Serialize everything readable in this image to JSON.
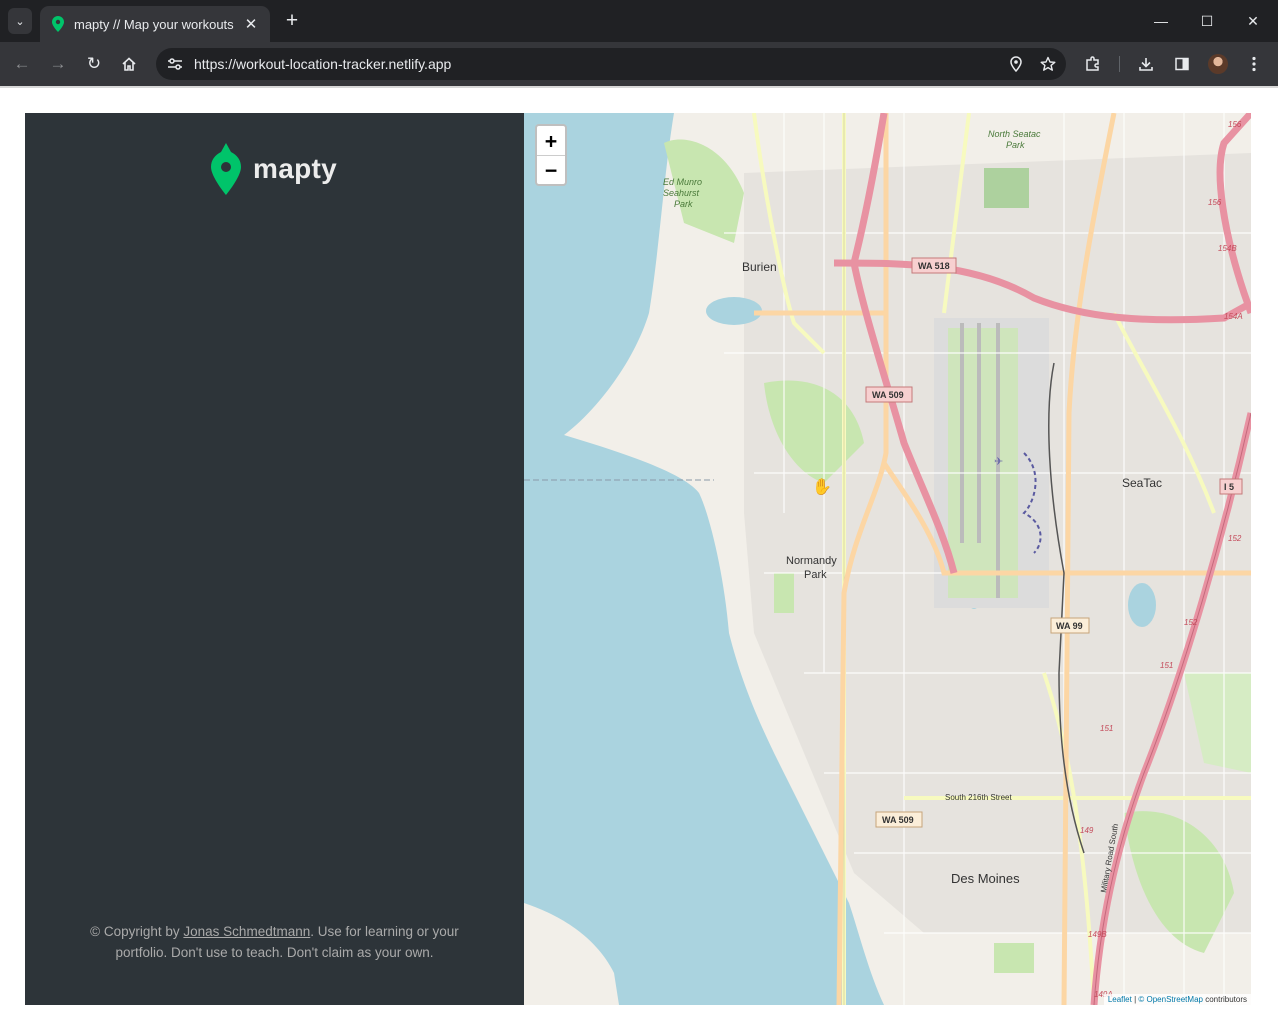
{
  "browser": {
    "tab_title": "mapty // Map your workouts",
    "url": "https://workout-location-tracker.netlify.app",
    "tab_close": "✕",
    "new_tab": "+",
    "window_controls": {
      "minimize": "—",
      "maximize": "☐",
      "close": "✕"
    },
    "icons": [
      "tab-list-icon",
      "back-icon",
      "forward-icon",
      "reload-icon",
      "home-icon",
      "site-info-icon",
      "location-icon",
      "bookmark-star-icon",
      "extensions-icon",
      "download-icon",
      "side-panel-icon",
      "profile-avatar",
      "menu-icon"
    ]
  },
  "sidebar": {
    "logo_text": "mapty",
    "copyright": {
      "prefix": "© Copyright by ",
      "author": "Jonas Schmedtmann",
      "suffix": ". Use for learning or your portfolio. Don't use to teach. Don't claim as your own."
    }
  },
  "map": {
    "zoom_in": "+",
    "zoom_out": "−",
    "attribution": {
      "leaflet": "Leaflet",
      "osm": "© OpenStreetMap",
      "contributors": " contributors"
    },
    "places": [
      "North SeaTac Park",
      "Ed Munro Seahurst Park",
      "Burien",
      "SeaTac",
      "Normandy Park",
      "Des Moines"
    ],
    "roads": [
      "WA 518",
      "WA 509",
      "WA 99",
      "I 5",
      "WA 509",
      "South 216th Street",
      "Military Road South"
    ],
    "colors": {
      "water": "#aad3df",
      "land": "#f2efe9",
      "park": "#c8e6b0",
      "motorway": "#e892a2",
      "trunk": "#f9b29c",
      "primary": "#fcd6a4",
      "secondary": "#f7fabf"
    }
  },
  "colors": {
    "sidebar_bg": "#2d3439",
    "brand_green": "#00c46a"
  }
}
